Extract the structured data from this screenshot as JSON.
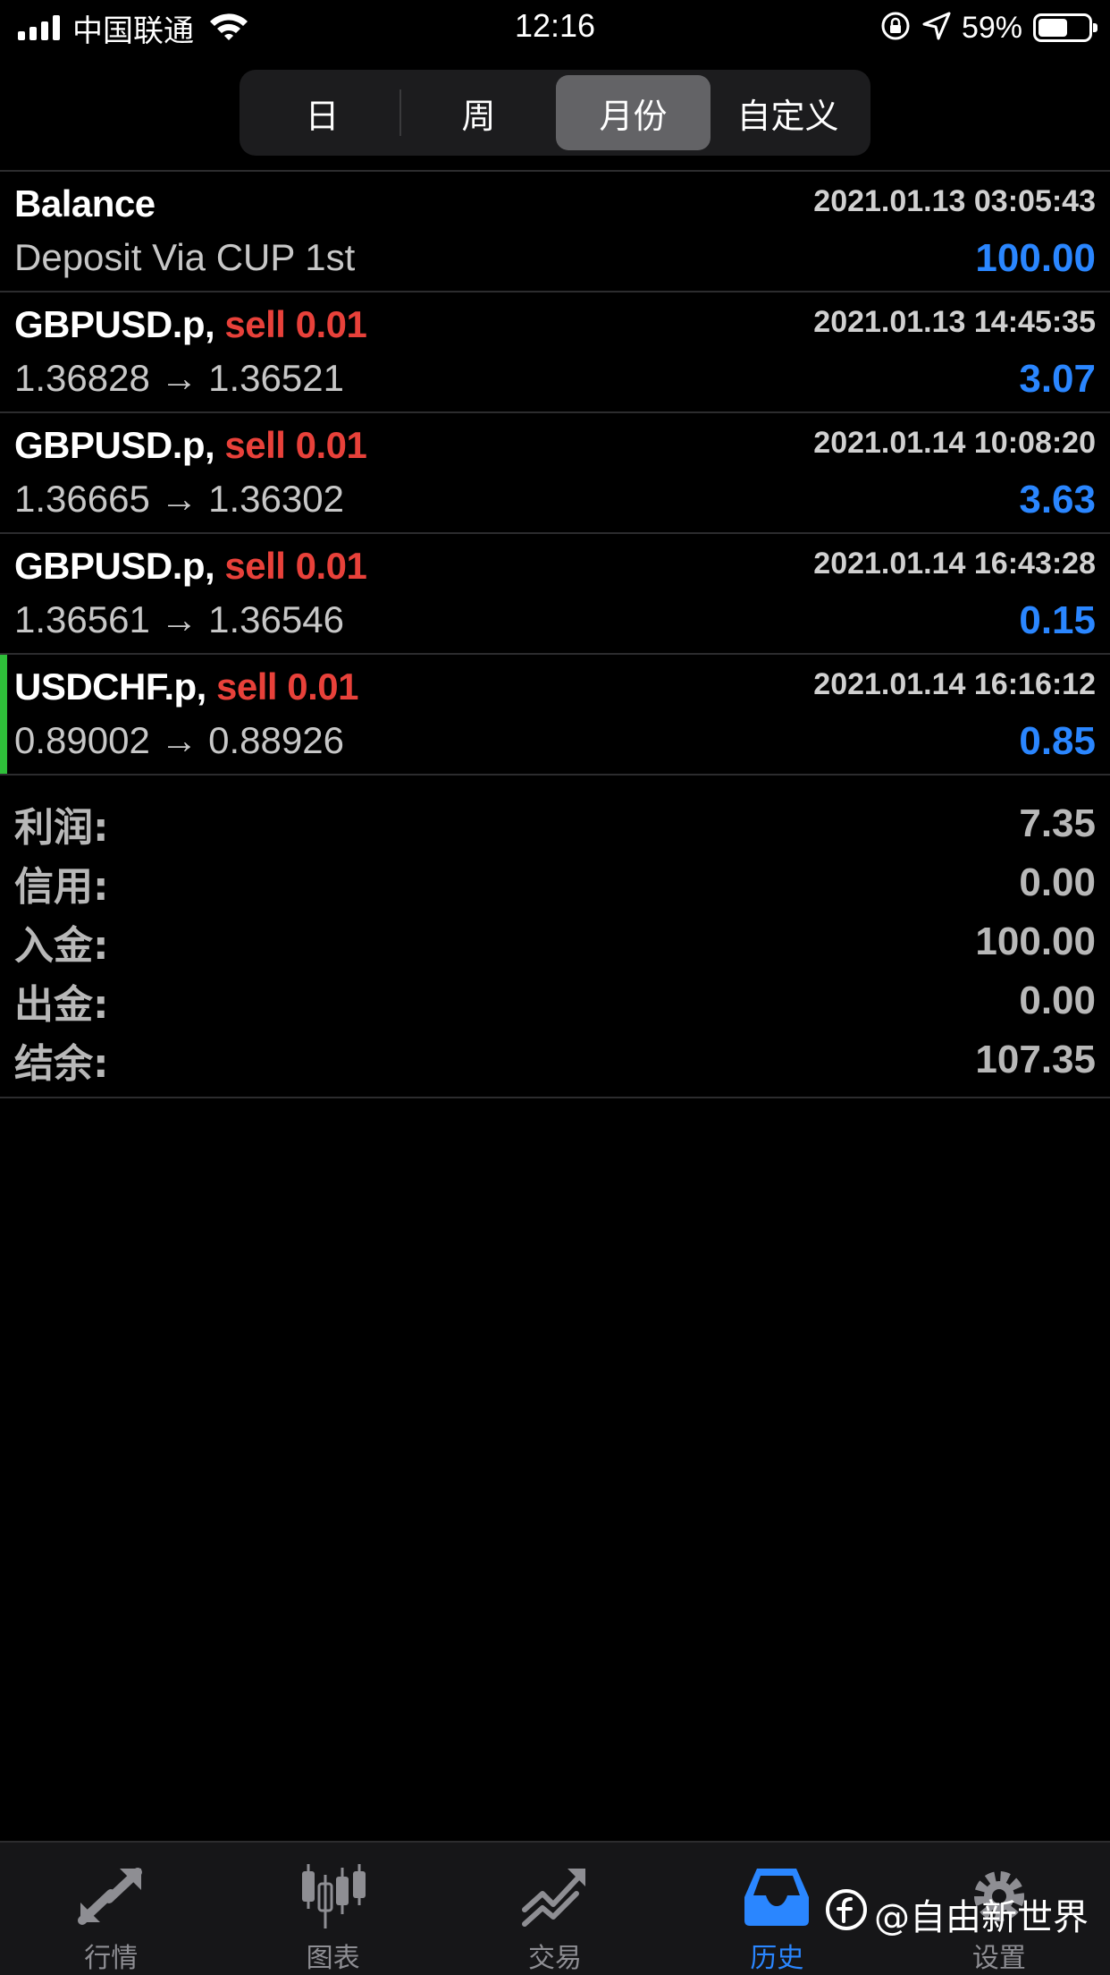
{
  "status_bar": {
    "carrier": "中国联通",
    "time": "12:16",
    "battery_percent": "59%",
    "battery_level": 0.59
  },
  "period_selector": {
    "options": [
      "日",
      "周",
      "月份",
      "自定义"
    ],
    "selected": "月份"
  },
  "deals": [
    {
      "title": "Balance",
      "side": "",
      "time": "2021.01.13 03:05:43",
      "detail": "Deposit Via CUP 1st",
      "amount": "100.00"
    },
    {
      "title": "GBPUSD.p,",
      "side": "sell 0.01",
      "time": "2021.01.13 14:45:35",
      "detail": "1.36828 → 1.36521",
      "amount": "3.07"
    },
    {
      "title": "GBPUSD.p,",
      "side": "sell 0.01",
      "time": "2021.01.14 10:08:20",
      "detail": "1.36665 → 1.36302",
      "amount": "3.63"
    },
    {
      "title": "GBPUSD.p,",
      "side": "sell 0.01",
      "time": "2021.01.14 16:43:28",
      "detail": "1.36561 → 1.36546",
      "amount": "0.15"
    },
    {
      "title": "USDCHF.p,",
      "side": "sell 0.01",
      "time": "2021.01.14 16:16:12",
      "detail": "0.89002 → 0.88926",
      "amount": "0.85"
    }
  ],
  "summary": [
    {
      "label": "利润:",
      "value": "7.35"
    },
    {
      "label": "信用:",
      "value": "0.00"
    },
    {
      "label": "入金:",
      "value": "100.00"
    },
    {
      "label": "出金:",
      "value": "0.00"
    },
    {
      "label": "结余:",
      "value": "107.35"
    }
  ],
  "tabs": [
    {
      "label": "行情",
      "icon": "quotes-arrows-icon"
    },
    {
      "label": "图表",
      "icon": "candlestick-chart-icon"
    },
    {
      "label": "交易",
      "icon": "trade-trend-icon"
    },
    {
      "label": "历史",
      "icon": "history-inbox-icon"
    },
    {
      "label": "设置",
      "icon": "gear-icon"
    }
  ],
  "active_tab": "历史",
  "watermark": "@自由新世界",
  "colors": {
    "background": "#000000",
    "sell": "#e8413a",
    "amount": "#2a86ff",
    "active_tab": "#2a86ff",
    "accent_bar": "#2fbf3a"
  }
}
